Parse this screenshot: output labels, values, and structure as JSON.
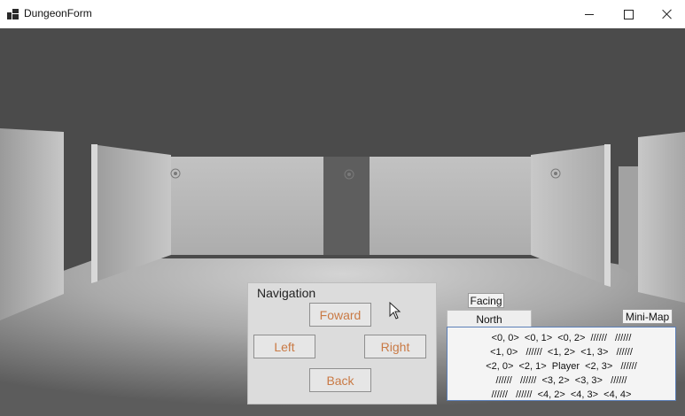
{
  "window": {
    "title": "DungeonForm",
    "icon": "app-window-icon",
    "controls": [
      "minimize-icon",
      "maximize-icon",
      "close-icon"
    ]
  },
  "viewport": {
    "colors": {
      "sky": "#4d4d4d",
      "floor_center": "#cfcfcf",
      "floor_edge": "#5a5a5a",
      "wall_light": "#c9c9c9",
      "wall_dark": "#8a8a8a",
      "wall_far": "#b5b5b5"
    }
  },
  "navigation": {
    "title": "Navigation",
    "forward_label": "Foward",
    "left_label": "Left",
    "right_label": "Right",
    "back_label": "Back",
    "button_text_color": "#c97a45"
  },
  "facing": {
    "label": "Facing",
    "value": "North"
  },
  "minimap": {
    "label": "Mini-Map",
    "rows": [
      "<0, 0>  <0, 1>  <0, 2>  //////   //////",
      "<1, 0>   //////  <1, 2>  <1, 3>   //////",
      "<2, 0>  <2, 1>  Player  <2, 3>   //////",
      "//////   //////  <3, 2>  <3, 3>   //////",
      "//////   //////  <4, 2>  <4, 3>  <4, 4>"
    ]
  }
}
